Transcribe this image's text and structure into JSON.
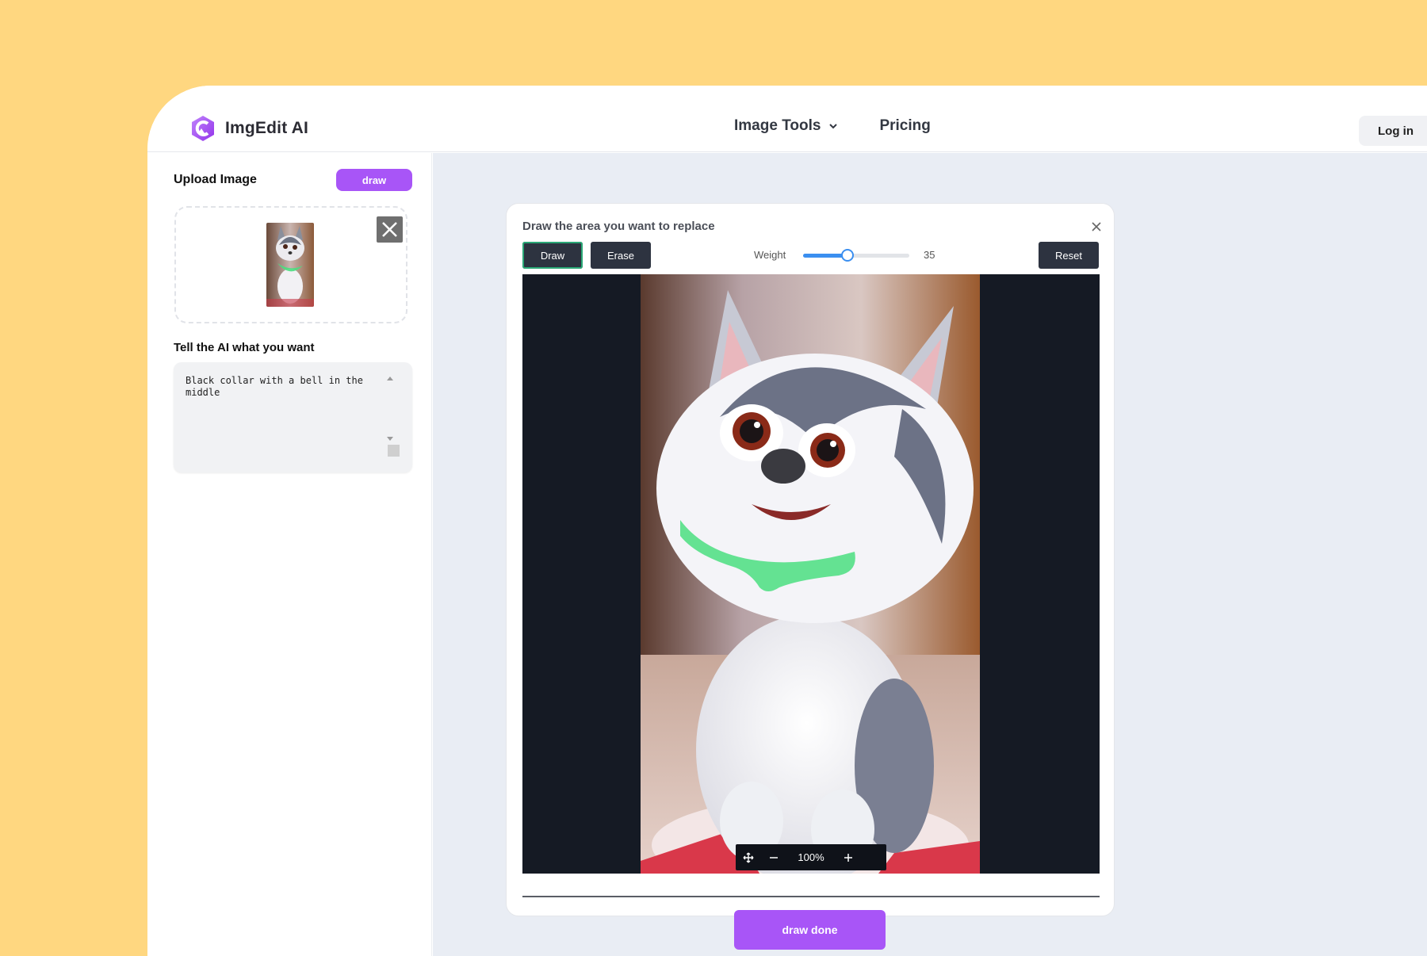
{
  "app": {
    "name": "ImgEdit AI"
  },
  "nav": {
    "image_tools": "Image Tools",
    "pricing": "Pricing",
    "login": "Log in"
  },
  "left": {
    "upload_title": "Upload Image",
    "draw_label": "draw",
    "prompt_label": "Tell the AI what you want",
    "prompt_value": "Black collar with a bell in the middle"
  },
  "editor": {
    "title": "Draw the area you want to replace",
    "draw_label": "Draw",
    "erase_label": "Erase",
    "reset_label": "Reset",
    "weight_label": "Weight",
    "weight_value": "35",
    "weight_fraction": 0.42,
    "zoom": "100%",
    "done_label": "draw done"
  },
  "colors": {
    "accent": "#A855F7",
    "mask": "#4ADE80",
    "page_bg": "#FFD780",
    "canvas_bg": "#151A24"
  },
  "icons": [
    "logo-icon",
    "chevron-down-icon",
    "close-icon",
    "move-icon",
    "zoom-out-icon",
    "zoom-in-icon"
  ]
}
